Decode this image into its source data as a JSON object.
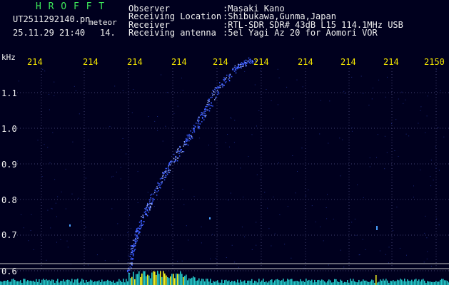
{
  "header": {
    "logo": "H R O F F T",
    "filename": "UT2511292140.pn",
    "type_label": "meteor",
    "datetime": "25.11.29 21:40",
    "extra": "14.",
    "labels": {
      "observer": "Observer",
      "location": "Receiving Location",
      "receiver": "Receiver",
      "antenna": "Receiving antenna"
    },
    "values": {
      "observer": ":Masaki Kano",
      "location": ":Shibukawa,Gunma,Japan",
      "receiver": ":RTL-SDR SDR# 43dB L15 114.1MHz USB",
      "antenna": ":5el Yagi Az 20 for Aomori VOR"
    }
  },
  "plot": {
    "y_unit": "kHz",
    "y_ticks": [
      "1.1",
      "1.0",
      "0.9",
      "0.8",
      "0.7",
      "0.6"
    ],
    "x_ticks": [
      "214",
      "214",
      "214",
      "214",
      "214",
      "214",
      "214",
      "214",
      "214",
      "2150"
    ],
    "colors": {
      "signal": "#3a5cff",
      "signal_core": "#9ab0ff",
      "grid": "#404070",
      "baseline": "#c8c8c8",
      "spectrum_low": "#23c8c8",
      "spectrum_high": "#f0f020"
    }
  }
}
